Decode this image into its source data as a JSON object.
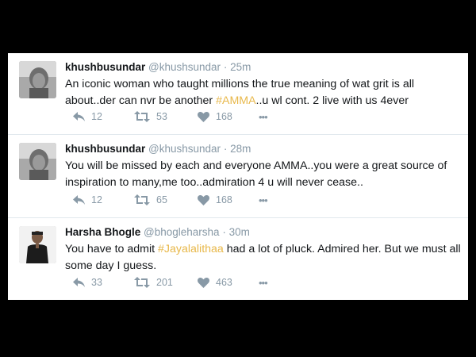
{
  "tweets": [
    {
      "name": "khushbusundar",
      "handle": "@khushsundar",
      "separator": "·",
      "time": "25m",
      "text_parts": [
        "An iconic woman who taught millions the true meaning of wat grit is all about..der can nvr be another ",
        "#AMMA",
        "..u wl cont. 2 live with us 4ever"
      ],
      "replies": "12",
      "retweets": "53",
      "likes": "168",
      "more": "•••"
    },
    {
      "name": "khushbusundar",
      "handle": "@khushsundar",
      "separator": "·",
      "time": "28m",
      "text_parts": [
        "You will be missed by each and everyone AMMA..you were a great source of inspiration to many,me too..admiration 4 u will never cease.."
      ],
      "replies": "12",
      "retweets": "65",
      "likes": "168",
      "more": "•••"
    },
    {
      "name": "Harsha Bhogle",
      "handle": "@bhogleharsha",
      "separator": "·",
      "time": "30m",
      "text_parts": [
        "You have to admit ",
        "#Jayalalithaa",
        " had a lot of pluck. Admired her. But we must all some day I guess."
      ],
      "replies": "33",
      "retweets": "201",
      "likes": "463",
      "more": "•••"
    }
  ],
  "colors": {
    "hashtag": "#e8b84a",
    "meta": "#8899a6",
    "text": "#14171a",
    "divider": "#e1e8ed"
  },
  "icons": [
    "reply-icon",
    "retweet-icon",
    "like-icon",
    "more-icon"
  ]
}
